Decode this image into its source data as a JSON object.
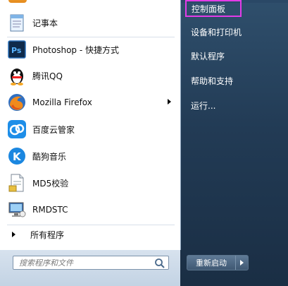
{
  "left_menu": {
    "items": [
      {
        "label": "记事本",
        "icon": "notepad-icon"
      },
      {
        "label": "Photoshop - 快捷方式",
        "icon": "photoshop-icon"
      },
      {
        "label": "腾讯QQ",
        "icon": "qq-penguin-icon"
      },
      {
        "label": "Mozilla Firefox",
        "icon": "firefox-icon",
        "has_submenu": true
      },
      {
        "label": "百度云管家",
        "icon": "baidu-cloud-icon"
      },
      {
        "label": "酷狗音乐",
        "icon": "kugou-icon"
      },
      {
        "label": "MD5校验",
        "icon": "document-icon"
      },
      {
        "label": "RMDSTC",
        "icon": "remote-desktop-icon"
      }
    ],
    "all_programs": "所有程序"
  },
  "search": {
    "placeholder": "搜索程序和文件"
  },
  "right_menu": {
    "items": [
      {
        "label": "控制面板",
        "highlighted": true
      },
      {
        "label": "设备和打印机"
      },
      {
        "label": "默认程序"
      },
      {
        "label": "帮助和支持"
      },
      {
        "label": "运行..."
      }
    ]
  },
  "shutdown": {
    "label": "重新启动"
  },
  "colors": {
    "highlight_border": "#e33ce8",
    "right_pane": "#223b55"
  }
}
